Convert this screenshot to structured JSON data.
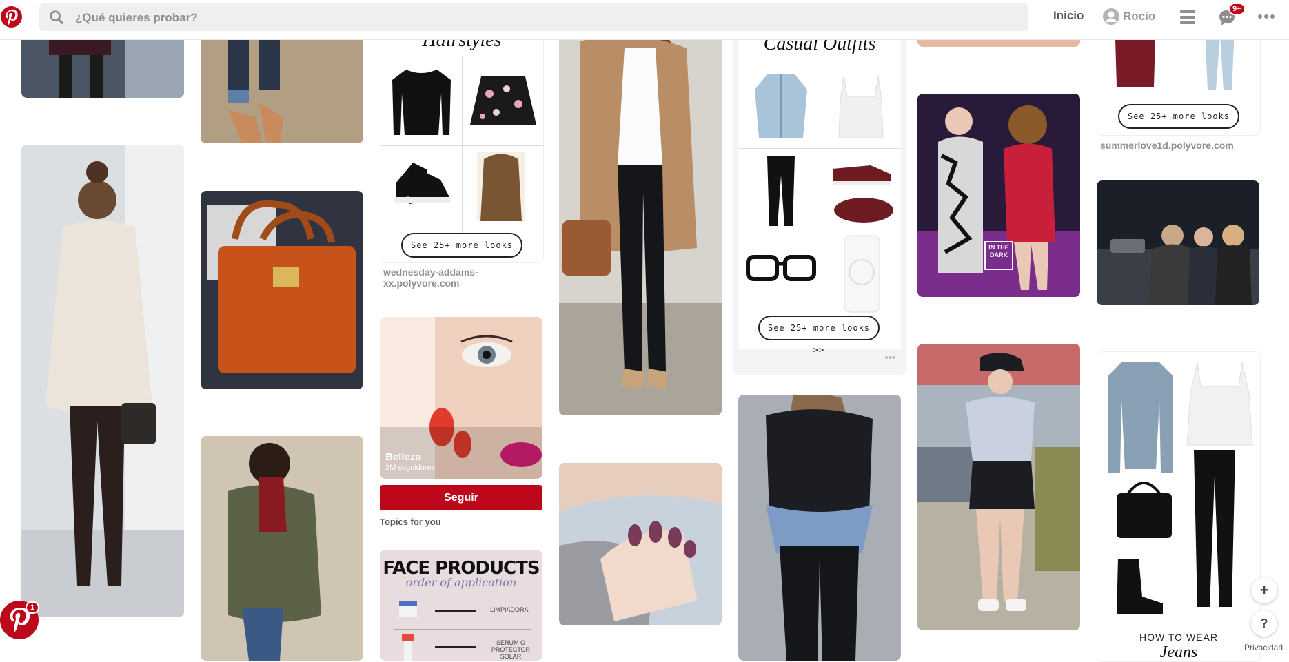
{
  "header": {
    "search_placeholder": "¿Qué quieres probar?",
    "home_label": "Inicio",
    "user_label": "Rocio",
    "notifications_badge": "9+"
  },
  "pins": {
    "hairstyles_title": "Hairstyles",
    "casual_title": "Casual Outfits",
    "polyvore_more_1": "See 25+ more looks >>",
    "polyvore_more_2": "See 25+ more looks >>",
    "polyvore_more_3": "See 25+ more looks >>",
    "source_1": "wednesday-addams-xx.polyvore.com",
    "source_2": "summerlove1d.polyvore.com",
    "topic_name": "Belleza",
    "topic_followers": "2M seguidores",
    "follow_label": "Seguir",
    "topics_caption": "Topics for you",
    "face_title": "FACE PRODUCTS",
    "face_subtitle": "order of application",
    "face_step_1": "LIMPIADORA",
    "face_step_2": "SERUM O PROTECTOR SOLAR",
    "in_the_dark": "IN THE DARK",
    "how_to_wear": "HOW TO WEAR",
    "jeans": "Jeans"
  },
  "floating": {
    "pinterest_badge": "1",
    "add_label": "+",
    "help_label": "?",
    "privacy_label": "Privacidad"
  },
  "colors": {
    "brand": "#bd081c"
  }
}
